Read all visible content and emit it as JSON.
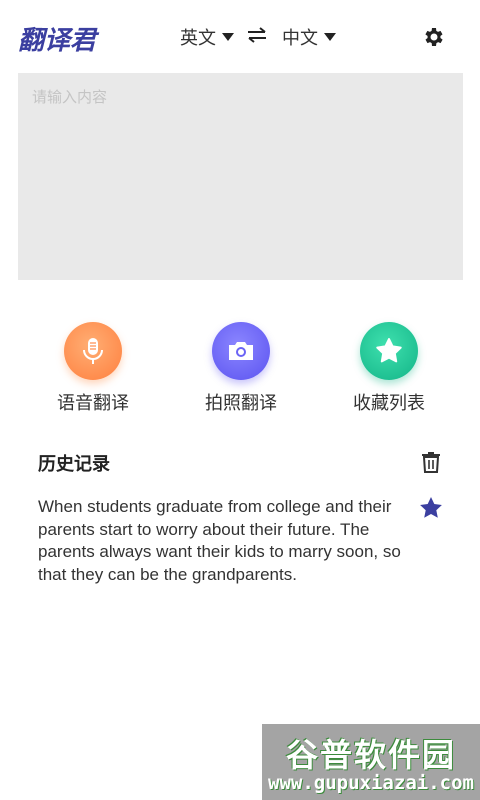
{
  "header": {
    "app_name": "翻译君",
    "source_language": "英文",
    "target_language": "中文",
    "swap_icon": "swap-arrows-icon",
    "settings_icon": "gear-icon"
  },
  "input": {
    "placeholder": "请输入内容",
    "value": ""
  },
  "actions": [
    {
      "label": "语音翻译",
      "icon": "microphone-icon",
      "color": "#ff8a4a"
    },
    {
      "label": "拍照翻译",
      "icon": "camera-icon",
      "color": "#6a63f5"
    },
    {
      "label": "收藏列表",
      "icon": "star-icon",
      "color": "#1cc394"
    }
  ],
  "history": {
    "title": "历史记录",
    "clear_icon": "trash-icon",
    "items": [
      {
        "text": "When students graduate from college and their parents start to worry about their future. The parents always want their kids to marry soon, so that they can be the grandparents.",
        "starred": true,
        "star_color": "#3b3fa0"
      }
    ]
  },
  "watermark": {
    "title": "谷普软件园",
    "url": "www.gupuxiazai.com"
  }
}
